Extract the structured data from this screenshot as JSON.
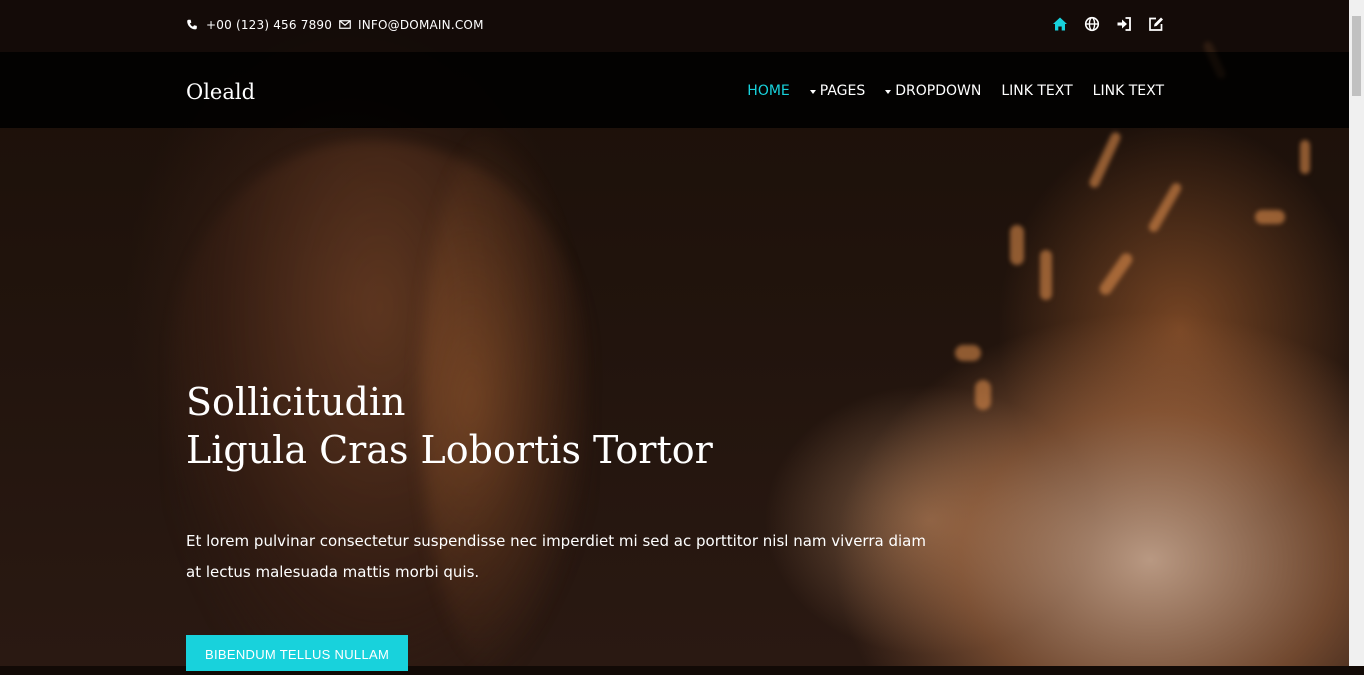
{
  "topbar": {
    "phone": "+00 (123) 456 7890",
    "email": "INFO@DOMAIN.COM",
    "icons": [
      "home-icon",
      "globe-icon",
      "sign-in-icon",
      "edit-icon"
    ],
    "icon_color": "#18d2dc"
  },
  "navbar": {
    "brand": "Oleald",
    "items": [
      {
        "label": "HOME",
        "active": true
      },
      {
        "label": "PAGES",
        "dropdown": true
      },
      {
        "label": "DROPDOWN",
        "dropdown": true
      },
      {
        "label": "LINK TEXT"
      },
      {
        "label": "LINK TEXT"
      }
    ]
  },
  "hero": {
    "title_line1": "Sollicitudin",
    "title_line2": "Ligula Cras Lobortis Tortor",
    "text": "Et lorem pulvinar consectetur suspendisse nec imperdiet mi sed ac porttitor nisl nam viverra diam at lectus malesuada mattis morbi quis.",
    "cta_label": "BIBENDUM TELLUS NULLAM"
  },
  "colors": {
    "accent": "#18d2dc",
    "navbar_bg": "#000000",
    "text": "#ffffff"
  }
}
